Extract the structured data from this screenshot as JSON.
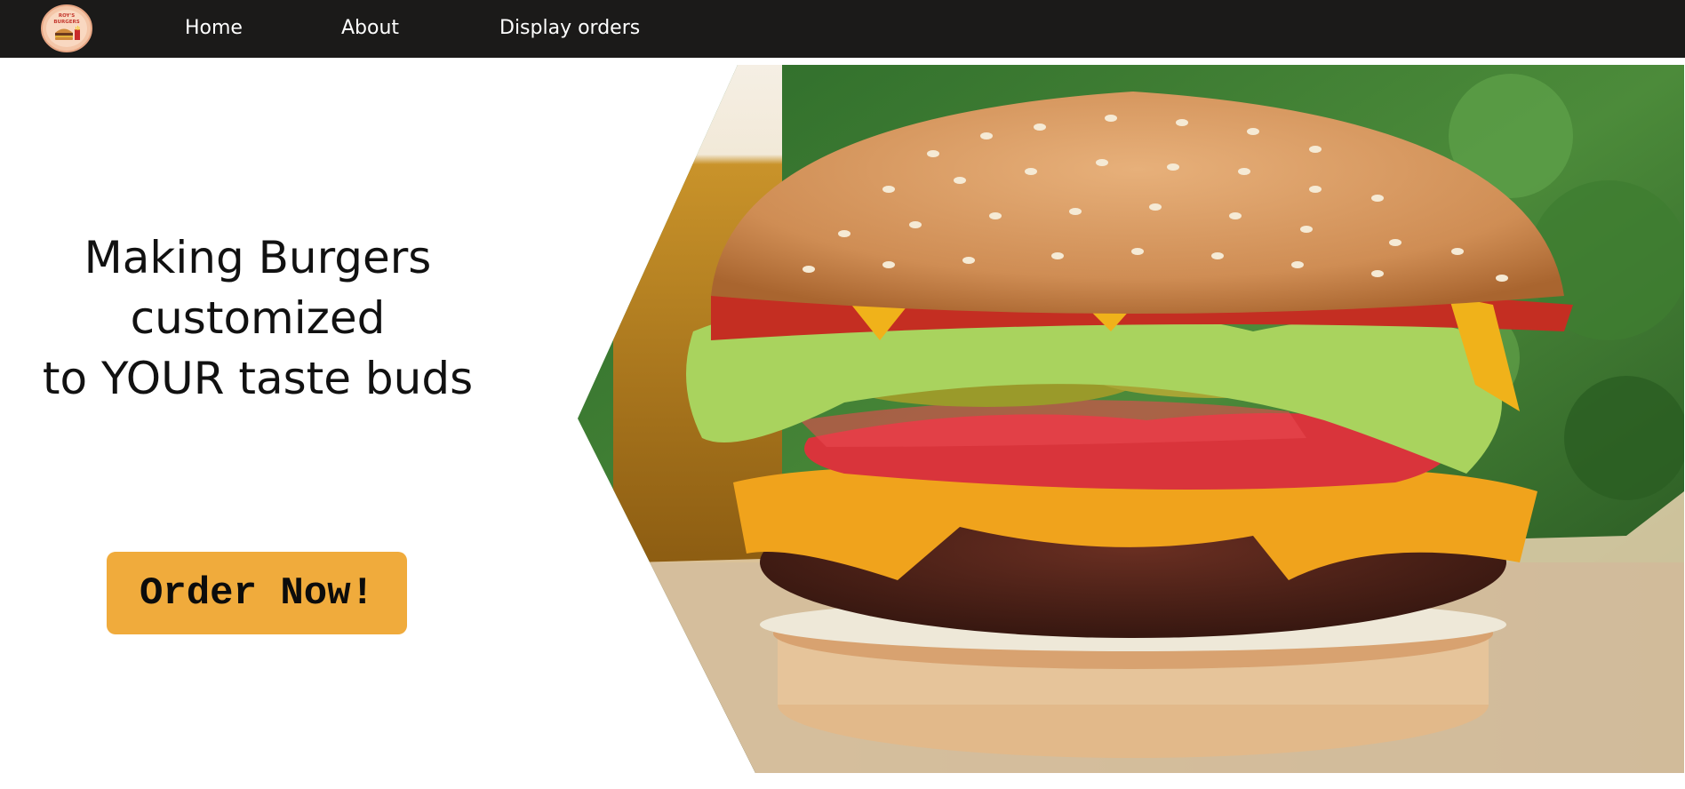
{
  "nav": {
    "logo_text": "ROY'S BURGERS",
    "links": [
      {
        "label": "Home"
      },
      {
        "label": "About"
      },
      {
        "label": "Display orders"
      }
    ]
  },
  "hero": {
    "headline_lines": [
      "Making Burgers",
      "customized",
      "to YOUR taste buds"
    ],
    "cta_label": "Order Now!"
  },
  "colors": {
    "navbar_bg": "#1b1a19",
    "cta_bg": "#f0ab3c",
    "logo_bg": "#f4c6a8"
  },
  "icons": {
    "logo": "burger-logo-icon",
    "hero": "burger-photo"
  }
}
